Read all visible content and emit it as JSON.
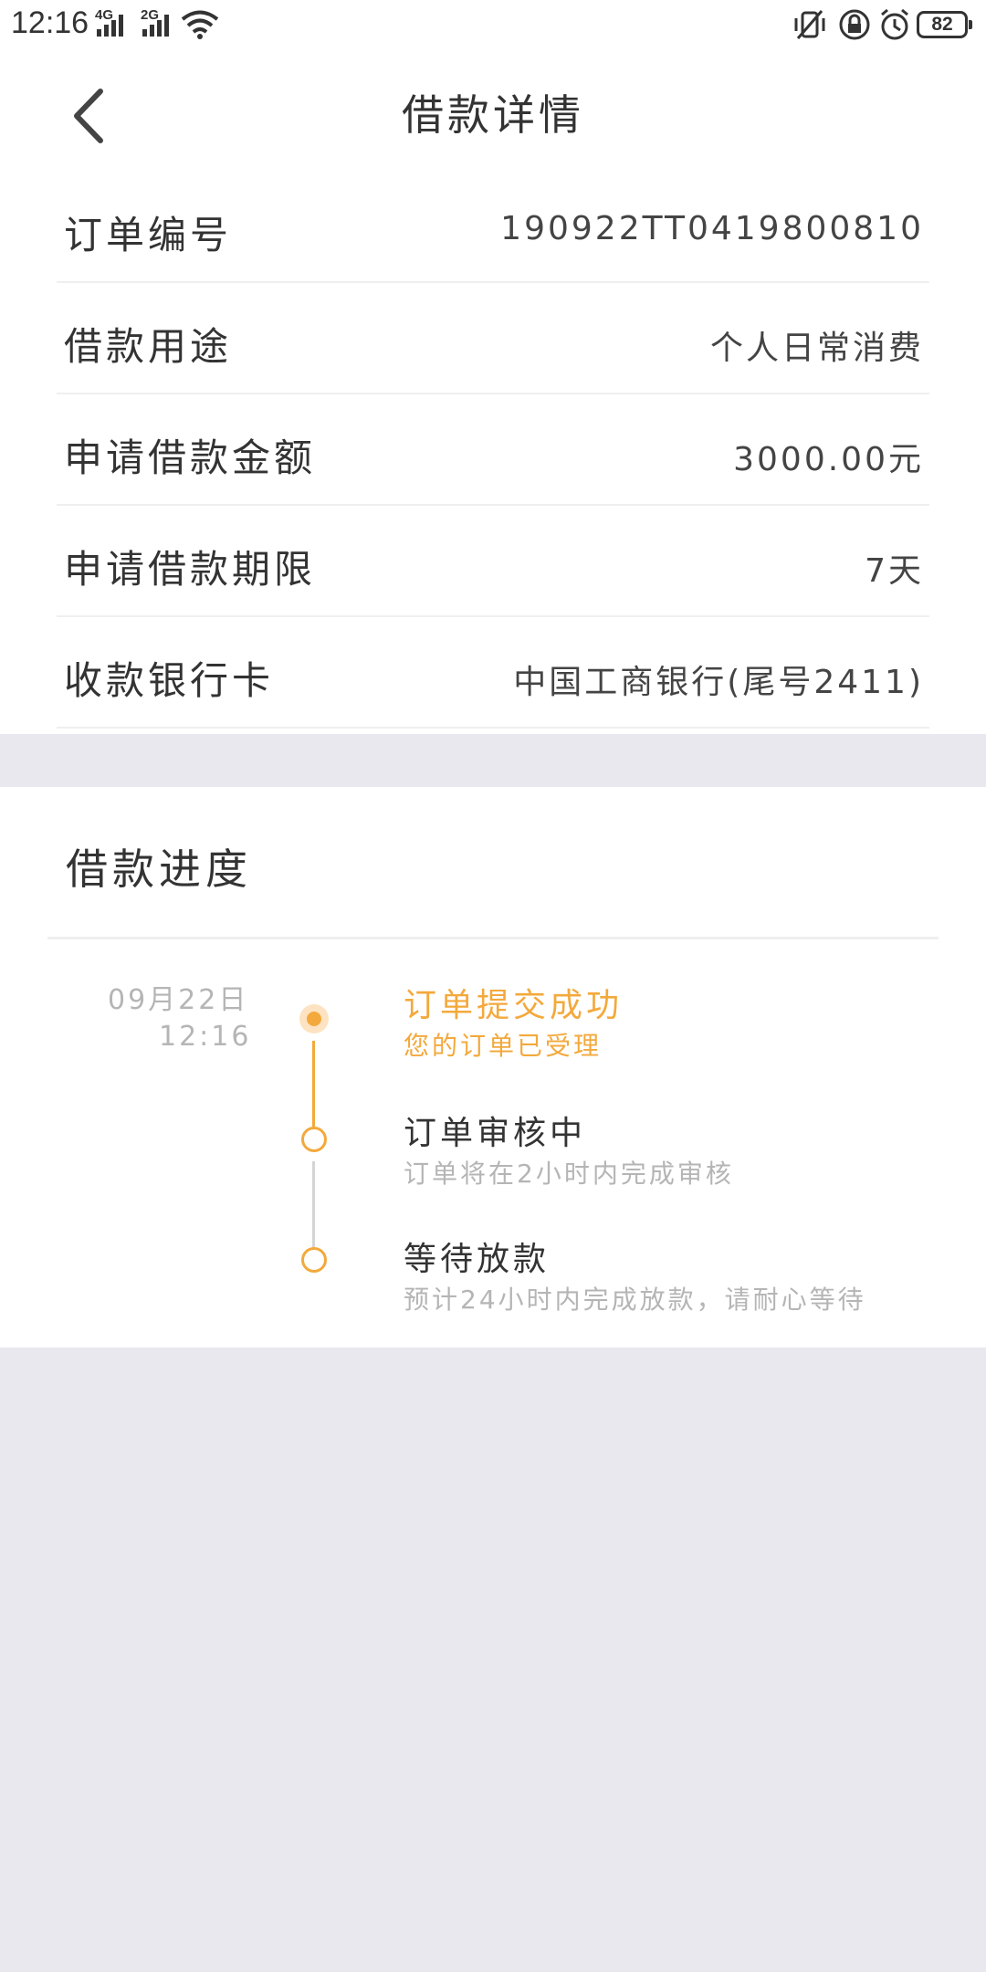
{
  "status_bar": {
    "time": "12:16",
    "network1": "4G",
    "network2": "2G",
    "battery": "82"
  },
  "header": {
    "title": "借款详情"
  },
  "details": [
    {
      "label": "订单编号",
      "value": "190922TT0419800810"
    },
    {
      "label": "借款用途",
      "value": "个人日常消费"
    },
    {
      "label": "申请借款金额",
      "value": "3000.00元"
    },
    {
      "label": "申请借款期限",
      "value": "7天"
    },
    {
      "label": "收款银行卡",
      "value": "中国工商银行(尾号2411)"
    }
  ],
  "progress": {
    "title": "借款进度",
    "date": "09月22日",
    "time": "12:16",
    "steps": [
      {
        "title": "订单提交成功",
        "subtitle": "您的订单已受理",
        "status": "done"
      },
      {
        "title": "订单审核中",
        "subtitle": "订单将在2小时内完成审核",
        "status": "pending"
      },
      {
        "title": "等待放款",
        "subtitle": "预计24小时内完成放款，请耐心等待",
        "status": "pending"
      }
    ]
  },
  "colors": {
    "accent": "#f3a93c",
    "accent_light": "#fde3c1",
    "background": "#e9e8ee",
    "text": "#333333",
    "muted": "#b5b5b5"
  }
}
